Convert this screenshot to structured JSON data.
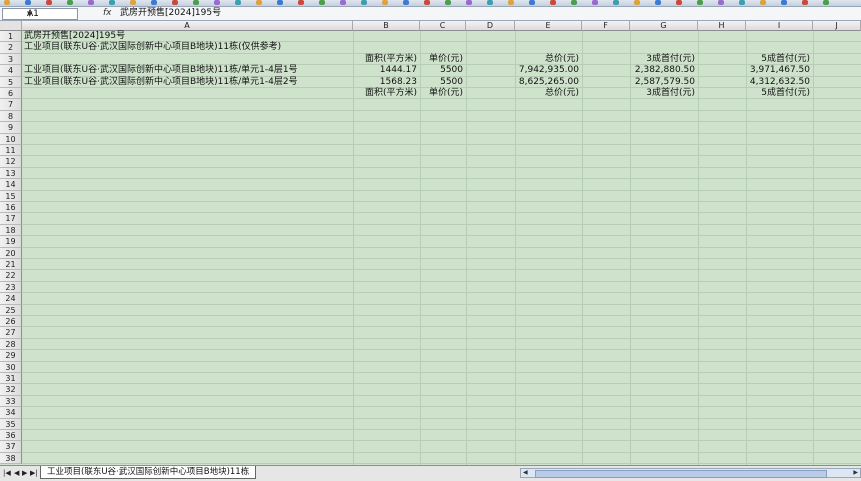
{
  "formula_bar": {
    "cell_ref": "A1",
    "fx": "fx",
    "content": "武房开预售[2024]195号"
  },
  "columns": [
    "A",
    "B",
    "C",
    "D",
    "E",
    "F",
    "G",
    "H",
    "I",
    "J"
  ],
  "rows": [
    "1",
    "2",
    "3",
    "4",
    "5",
    "6",
    "7",
    "8",
    "9",
    "10",
    "11",
    "12",
    "13",
    "14",
    "15",
    "16",
    "17",
    "18",
    "19",
    "20",
    "21",
    "22",
    "23",
    "24",
    "25",
    "26",
    "27",
    "28",
    "29",
    "30",
    "31",
    "32",
    "33",
    "34",
    "35",
    "36",
    "37",
    "38"
  ],
  "cells": {
    "r1": {
      "a": "武房开预售[2024]195号"
    },
    "r2": {
      "a": "工业项目(联东U谷·武汉国际创新中心项目B地块)11栋(仅供参考)"
    },
    "r3": {
      "b": "面积(平方米)",
      "c": "单价(元)",
      "e": "总价(元)",
      "g": "3成首付(元)",
      "i": "5成首付(元)"
    },
    "r4": {
      "a": "工业项目(联东U谷·武汉国际创新中心项目B地块)11栋/单元1-4层1号",
      "b": "1444.17",
      "c": "5500",
      "e": "7,942,935.00",
      "g": "2,382,880.50",
      "i": "3,971,467.50"
    },
    "r5": {
      "a": "工业项目(联东U谷·武汉国际创新中心项目B地块)11栋/单元1-4层2号",
      "b": "1568.23",
      "c": "5500",
      "e": "8,625,265.00",
      "g": "2,587,579.50",
      "i": "4,312,632.50"
    },
    "r6": {
      "b": "面积(平方米)",
      "c": "单价(元)",
      "e": "总价(元)",
      "g": "3成首付(元)",
      "i": "5成首付(元)"
    }
  },
  "sheet_tabs": [
    "工业项目(联东U谷·武汉国际创新中心项目B地块)11栋"
  ],
  "nav_icons": [
    "first-sheet-icon",
    "prev-sheet-icon",
    "next-sheet-icon",
    "last-sheet-icon"
  ],
  "colors": {
    "grid_bg": "#cfe3cc",
    "grid_line": "#b8cdb6"
  }
}
